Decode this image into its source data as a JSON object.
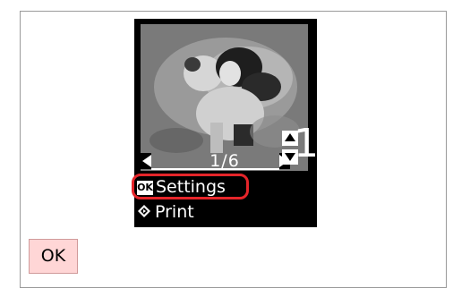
{
  "lcd": {
    "photo_counter": "1/6",
    "copies": "1",
    "menu": {
      "settings_chip": "OK",
      "settings_label": "Settings",
      "print_label": "Print"
    }
  },
  "colors": {
    "highlight": "#e5252a",
    "ok_button_bg": "#ffd6d6",
    "screen": "#000000"
  },
  "ok_button": {
    "label": "OK"
  }
}
